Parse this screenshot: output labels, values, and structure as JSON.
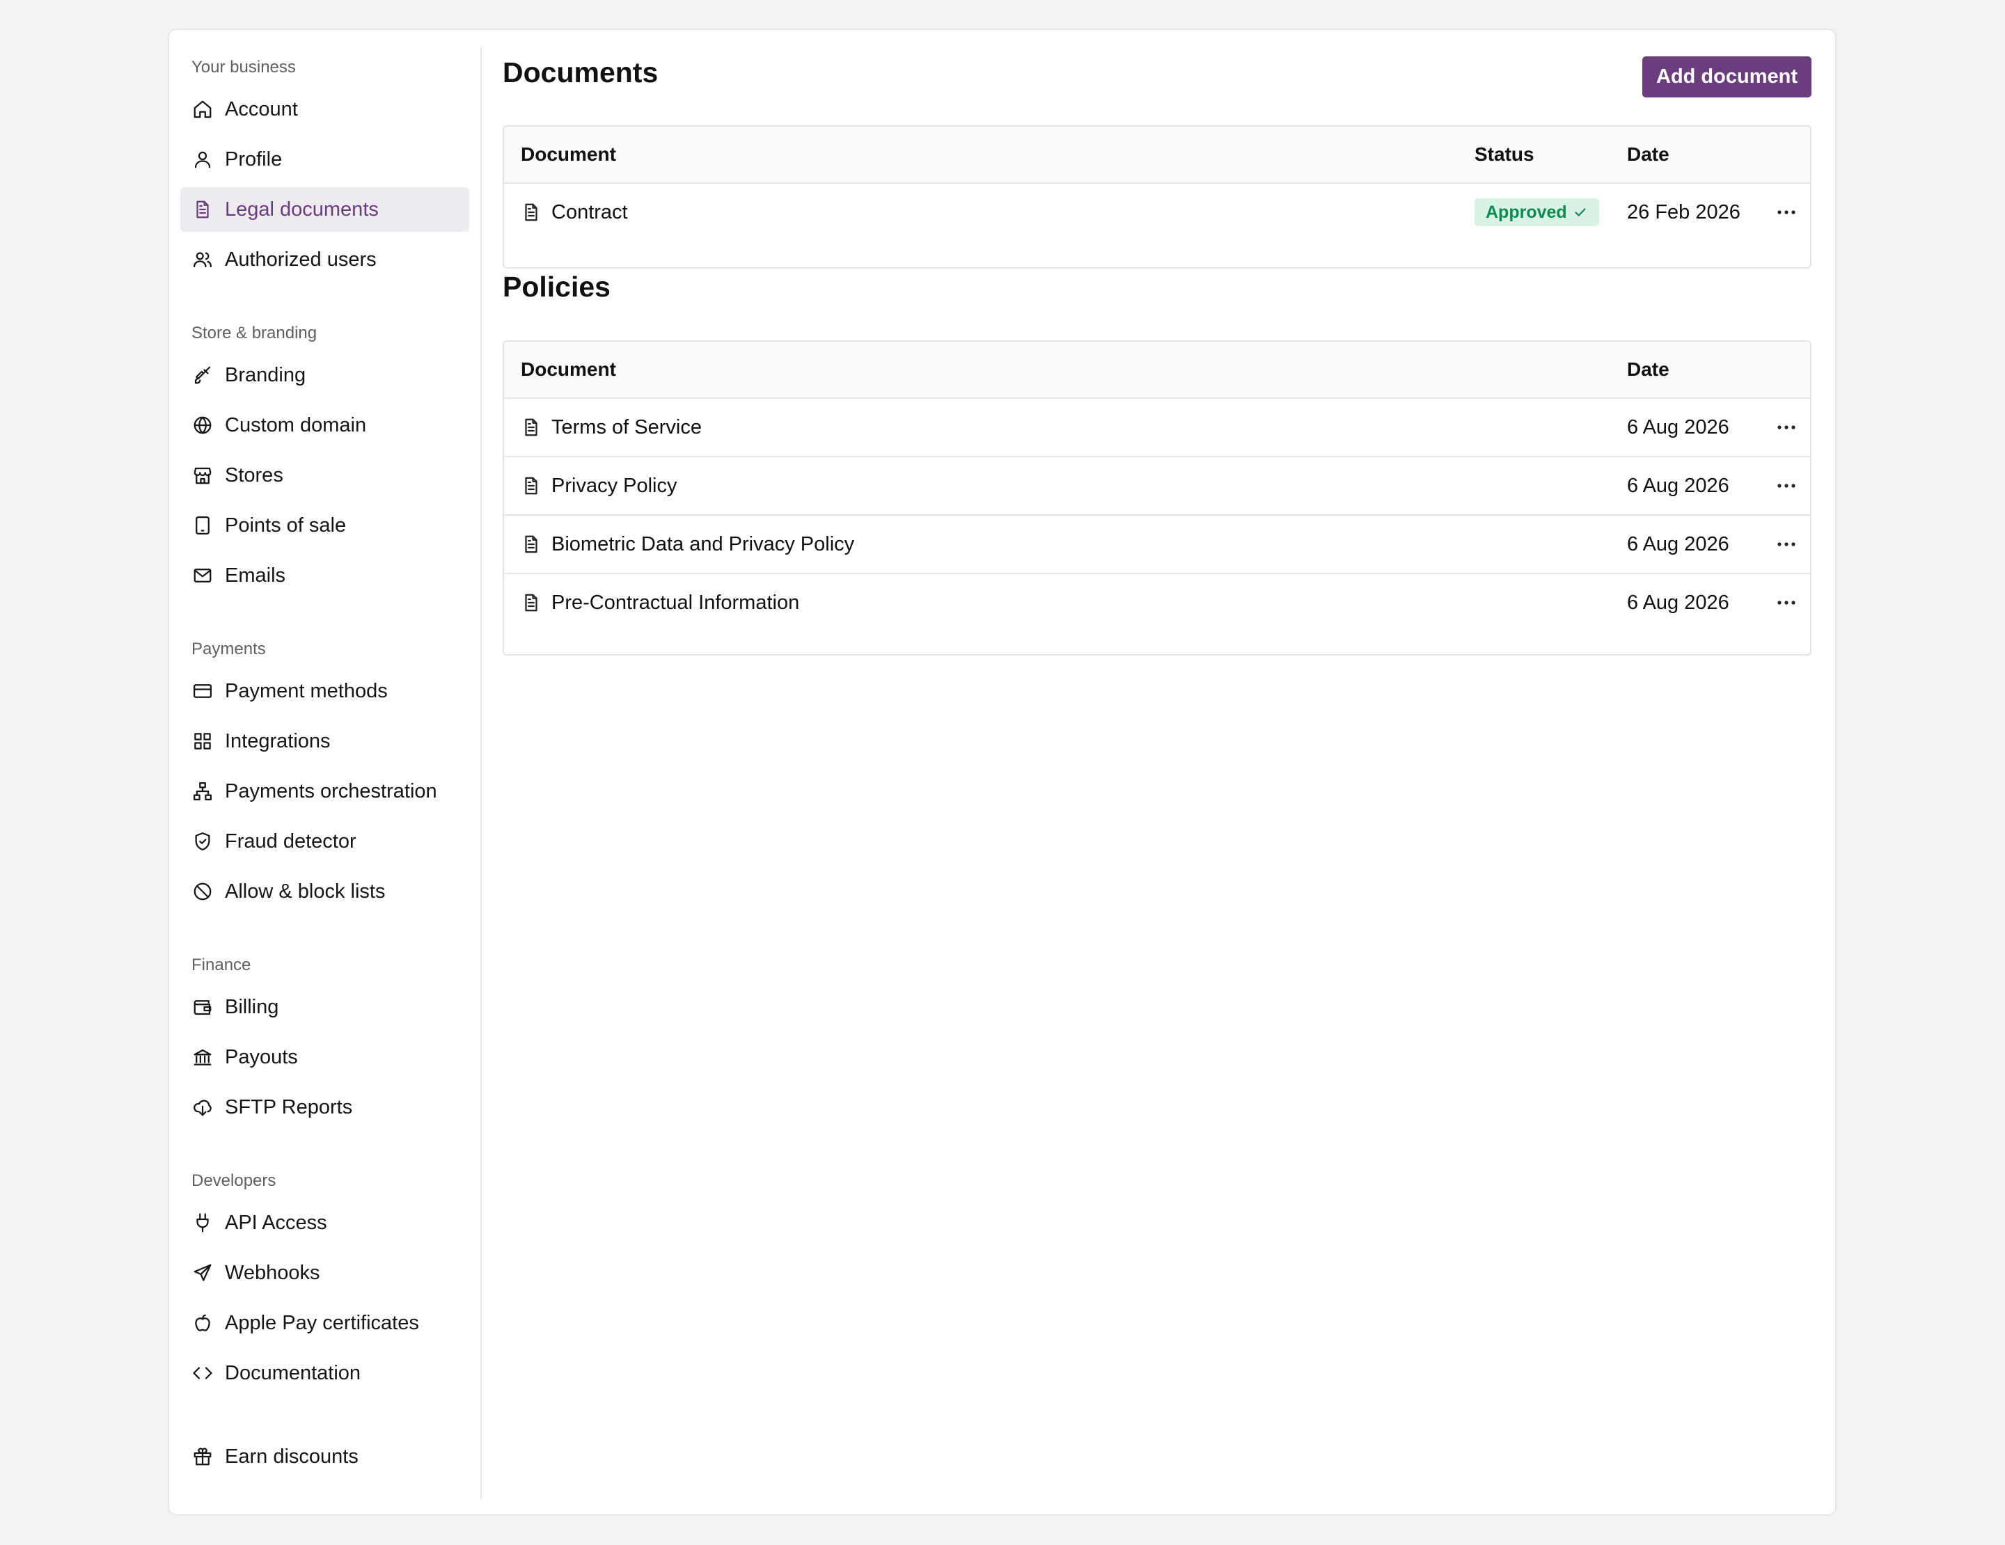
{
  "sidebar": {
    "sections": {
      "business": {
        "title": "Your business",
        "items": [
          "Account",
          "Profile",
          "Legal documents",
          "Authorized users"
        ]
      },
      "store": {
        "title": "Store & branding",
        "items": [
          "Branding",
          "Custom domain",
          "Stores",
          "Points of sale",
          "Emails"
        ]
      },
      "payments": {
        "title": "Payments",
        "items": [
          "Payment methods",
          "Integrations",
          "Payments orchestration",
          "Fraud detector",
          "Allow & block lists"
        ]
      },
      "finance": {
        "title": "Finance",
        "items": [
          "Billing",
          "Payouts",
          "SFTP Reports"
        ]
      },
      "developers": {
        "title": "Developers",
        "items": [
          "API Access",
          "Webhooks",
          "Apple Pay certificates",
          "Documentation"
        ]
      }
    },
    "earn_discounts": "Earn discounts",
    "active_item": "Legal documents",
    "active_color": "#6a3d7c"
  },
  "documents": {
    "title": "Documents",
    "add_button": "Add document",
    "columns": {
      "document": "Document",
      "status": "Status",
      "date": "Date"
    },
    "rows": [
      {
        "name": "Contract",
        "status": "Approved",
        "date": "26 Feb 2026"
      }
    ]
  },
  "policies": {
    "title": "Policies",
    "columns": {
      "document": "Document",
      "date": "Date"
    },
    "rows": [
      {
        "name": "Terms of Service",
        "date": "6 Aug 2026"
      },
      {
        "name": "Privacy Policy",
        "date": "6 Aug 2026"
      },
      {
        "name": "Biometric Data and Privacy Policy",
        "date": "6 Aug 2026"
      },
      {
        "name": "Pre-Contractual Information",
        "date": "6 Aug 2026"
      }
    ]
  },
  "colors": {
    "accent": "#6a3d7c",
    "approved_bg": "#d8f2e4",
    "approved_text": "#0d8a4f"
  }
}
